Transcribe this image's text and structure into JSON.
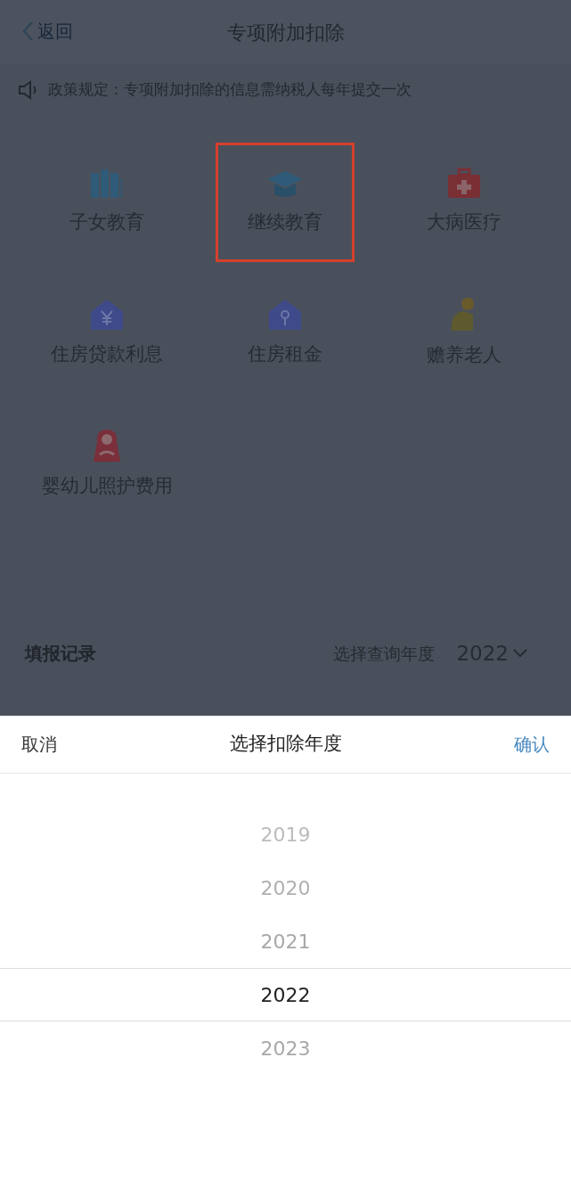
{
  "header": {
    "back": "返回",
    "title": "专项附加扣除"
  },
  "notice": "政策规定：专项附加扣除的信息需纳税人每年提交一次",
  "categories": [
    {
      "kind": "books",
      "label": "子女教育",
      "highlighted": false
    },
    {
      "kind": "cap",
      "label": "继续教育",
      "highlighted": true
    },
    {
      "kind": "medkit",
      "label": "大病医疗",
      "highlighted": false
    },
    {
      "kind": "house-yen",
      "label": "住房贷款利息",
      "highlighted": false
    },
    {
      "kind": "house-key",
      "label": "住房租金",
      "highlighted": false
    },
    {
      "kind": "elder",
      "label": "赡养老人",
      "highlighted": false
    },
    {
      "kind": "mother",
      "label": "婴幼儿照护费用",
      "highlighted": false
    }
  ],
  "records": {
    "title": "填报记录",
    "query_label": "选择查询年度",
    "year": "2022"
  },
  "picker": {
    "cancel": "取消",
    "title": "选择扣除年度",
    "confirm": "确认",
    "years": [
      {
        "label": "2019",
        "selected": false
      },
      {
        "label": "2020",
        "selected": false
      },
      {
        "label": "2021",
        "selected": false
      },
      {
        "label": "2022",
        "selected": true
      },
      {
        "label": "2023",
        "selected": false
      }
    ]
  }
}
